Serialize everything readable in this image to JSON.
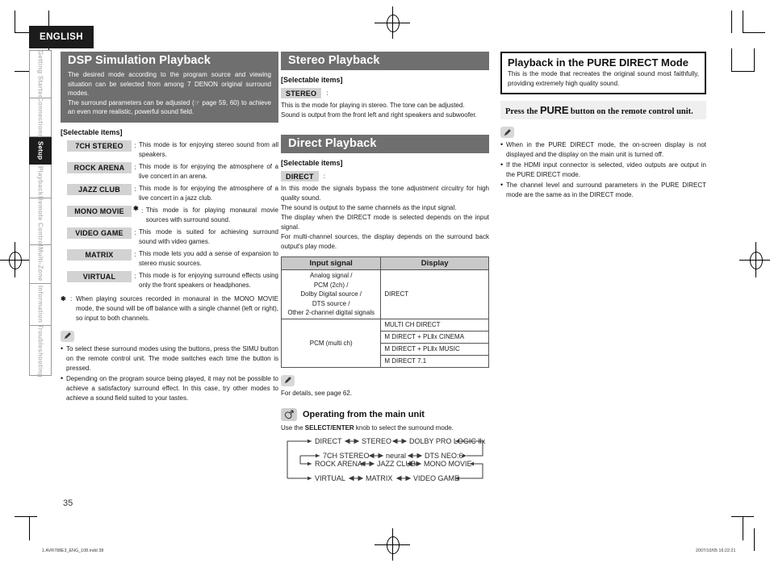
{
  "page": {
    "language_tab": "ENGLISH",
    "page_number": "35",
    "footer_left": "1.AVR788E3_ENG_108.indd   38",
    "footer_right": "2007/10/05   16:22:21"
  },
  "sidebar": {
    "items": [
      {
        "label": "Getting Started",
        "active": false
      },
      {
        "label": "Connections",
        "active": false
      },
      {
        "label": "Setup",
        "active": true
      },
      {
        "label": "Playback",
        "active": false
      },
      {
        "label": "Remote Control",
        "active": false
      },
      {
        "label": "Multi-Zone",
        "active": false
      },
      {
        "label": "Information",
        "active": false
      },
      {
        "label": "Troubleshooting",
        "active": false
      }
    ]
  },
  "dsp": {
    "title": "DSP Simulation Playback",
    "intro_1": "The desired mode according to the program source and viewing situation can be selected from among 7 DENON original surround modes.",
    "intro_2": "The surround parameters can be adjusted (☞ page 59, 60) to achieve an even more realistic, powerful sound field.",
    "selectable_label": "[Selectable items]",
    "modes": [
      {
        "name": "7CH STEREO",
        "star": "",
        "desc": "This mode is for enjoying stereo sound from all speakers."
      },
      {
        "name": "ROCK ARENA",
        "star": "",
        "desc": "This mode is for enjoying the atmosphere of a live concert in an arena."
      },
      {
        "name": "JAZZ CLUB",
        "star": "",
        "desc": "This mode is for enjoying the atmosphere of a live concert in a jazz club."
      },
      {
        "name": "MONO MOVIE",
        "star": "✱",
        "desc": "This mode is for playing monaural movie sources with surround sound."
      },
      {
        "name": "VIDEO GAME",
        "star": "",
        "desc": "This mode is suited for achieving surround sound with video games."
      },
      {
        "name": "MATRIX",
        "star": "",
        "desc": "This mode lets you add a sense of expansion to stereo music sources."
      },
      {
        "name": "VIRTUAL",
        "star": "",
        "desc": "This mode is for enjoying surround effects using only the front speakers or headphones."
      }
    ],
    "footnote_mark": "✱",
    "footnote": "When playing sources recorded in monaural in the MONO MOVIE mode, the sound will be off balance with a single channel (left or right), so input to both channels.",
    "notes": [
      "To select these surround modes using the buttons, press the SIMU button on the remote control unit. The mode switches each time the button is pressed.",
      "Depending on the program source being played, it may not be possible to achieve a satisfactory surround effect. In this case, try other modes to achieve a sound field suited to your tastes."
    ]
  },
  "stereo": {
    "title": "Stereo Playback",
    "selectable_label": "[Selectable items]",
    "chip": "STEREO",
    "colon": ":",
    "body_1": "This is the mode for playing in stereo. The tone can be adjusted.",
    "body_2": "Sound is output from the front left and right speakers and subwoofer."
  },
  "direct": {
    "title": "Direct Playback",
    "selectable_label": "[Selectable items]",
    "chip": "DIRECT",
    "colon": ":",
    "body_1": "In this mode the signals bypass the tone adjustment circuitry for high quality sound.",
    "body_2": "The sound is output to the same channels as the input signal.",
    "body_3": "The display when the DIRECT mode is selected depends on the input signal.",
    "body_4": "For multi-channel sources, the display depends on the surround back output's play mode.",
    "table": {
      "headers": [
        "Input signal",
        "Display"
      ],
      "rows": [
        {
          "signal": [
            "Analog signal /",
            "PCM (2ch) /",
            "Dolby Digital source /",
            "DTS source /",
            "Other 2-channel digital signals"
          ],
          "displays": [
            "DIRECT"
          ]
        },
        {
          "signal": [
            "PCM (multi ch)"
          ],
          "displays": [
            "MULTI CH DIRECT",
            "M DIRECT + PLⅡx CINEMA",
            "M DIRECT + PLⅡx MUSIC",
            "M DIRECT 7.1"
          ]
        }
      ]
    },
    "note": "For details, see page 62."
  },
  "operating": {
    "title": "Operating from the main unit",
    "sub_prefix": "Use the ",
    "sub_bold": "SELECT/ENTER",
    "sub_suffix": " knob to select the surround mode.",
    "flow_rows": [
      [
        "DIRECT",
        "STEREO",
        "DOLBY PRO LOGIC Ⅱx"
      ],
      [
        "7CH STEREO",
        "neural",
        "DTS NEO:6"
      ],
      [
        "ROCK ARENA",
        "JAZZ CLUB",
        "MONO MOVIE"
      ],
      [
        "VIRTUAL",
        "MATRIX",
        "VIDEO GAME"
      ]
    ]
  },
  "pure": {
    "title": "Playback in the PURE DIRECT Mode",
    "subtitle": "This is the mode that recreates the original sound most faithfully, providing extremely high quality sound.",
    "press_prefix": "Press the ",
    "press_big": "PURE",
    "press_suffix": " button on the remote control unit.",
    "notes": [
      "When in the PURE DIRECT mode, the on-screen display is not displayed and the display on the main unit is turned off.",
      "If the HDMI input connector is selected, video outputs are output in the PURE DIRECT mode.",
      "The channel level and surround parameters in the PURE DIRECT mode are the same as in the DIRECT mode."
    ]
  },
  "colors": {
    "header_bar": "#6f6f6f",
    "chip_gray": "#d2d2d2",
    "tab_black": "#1c1c1c",
    "band_gray": "#efefef"
  }
}
